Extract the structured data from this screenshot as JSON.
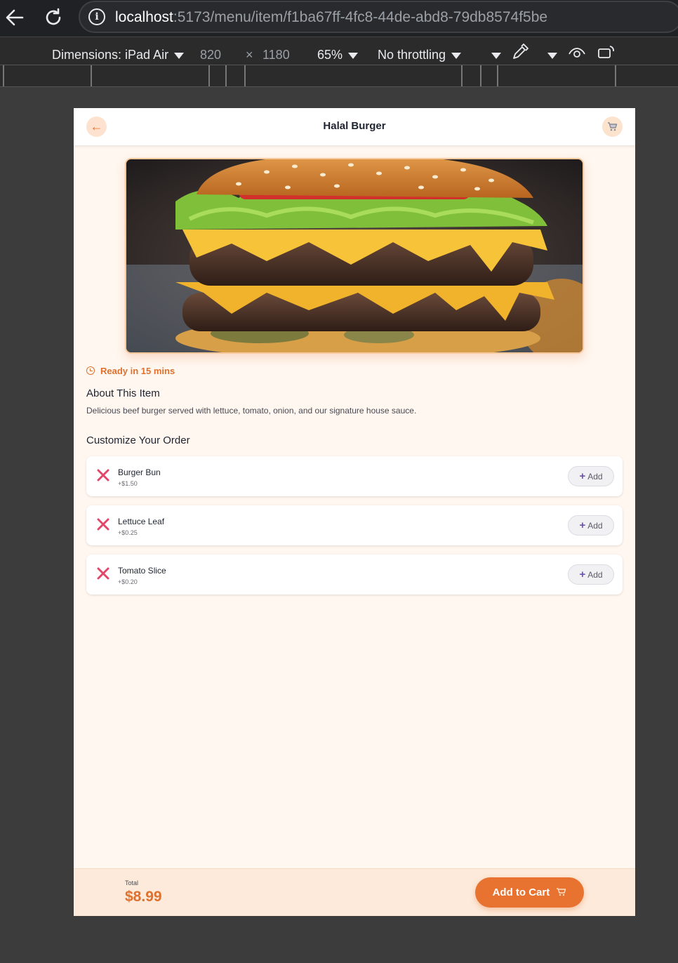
{
  "browser": {
    "url_host": "localhost",
    "url_path": ":5173/menu/item/f1ba67ff-4fc8-44de-abd8-79db8574f5be",
    "device_label": "Dimensions: iPad Air",
    "width_value": "820",
    "times_sign": "×",
    "height_value": "1180",
    "zoom": "65%",
    "throttling": "No throttling"
  },
  "header": {
    "title": "Halal Burger",
    "back_glyph": "←"
  },
  "item": {
    "ready_text": "Ready in 15 mins",
    "about_title": "About This Item",
    "description": "Delicious beef burger served with lettuce, tomato, onion, and our signature house sauce.",
    "customize_title": "Customize Your Order"
  },
  "options": [
    {
      "name": "Burger Bun",
      "price": "+$1.50",
      "add_label": "Add"
    },
    {
      "name": "Lettuce Leaf",
      "price": "+$0.25",
      "add_label": "Add"
    },
    {
      "name": "Tomato Slice",
      "price": "+$0.20",
      "add_label": "Add"
    }
  ],
  "footer": {
    "total_label": "Total",
    "total_value": "$8.99",
    "cta_label": "Add to Cart"
  },
  "colors": {
    "accent": "#e8722f",
    "background": "#fff7f0",
    "remove": "#e0476a",
    "add_plus": "#6a52b0"
  }
}
